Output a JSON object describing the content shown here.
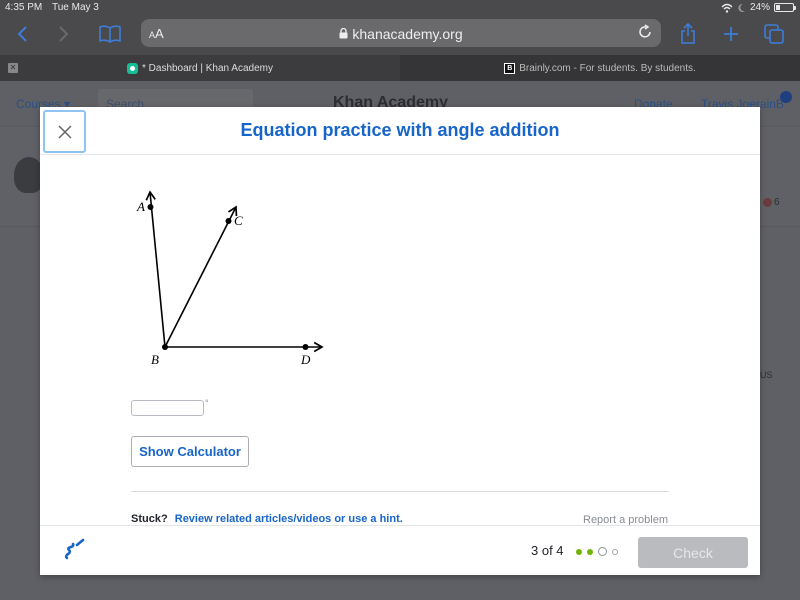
{
  "status_bar": {
    "time": "4:35 PM",
    "date": "Tue May 3",
    "battery_percent": "24%",
    "battery_level": 0.24,
    "icons": [
      "wifi-icon",
      "moon-icon",
      "battery-icon"
    ]
  },
  "browser": {
    "text_size_label": "AA",
    "url": "khanacademy.org",
    "tabs": [
      {
        "title": "* Dashboard | Khan Academy",
        "active": true,
        "icon": "khan-academy-favicon"
      },
      {
        "title": "Brainly.com - For students. By students.",
        "active": false,
        "icon": "brainly-favicon"
      }
    ]
  },
  "background_page": {
    "courses_label": "Courses ▾",
    "search_placeholder": "Search",
    "logo_text": "Khan Academy",
    "donate_label": "Donate",
    "user_name": "Travis JoerainB",
    "badge_count": "6",
    "partial_text": "US"
  },
  "modal": {
    "title": "Equation practice with angle addition",
    "close_label": "×",
    "diagram": {
      "points": [
        {
          "label": "A"
        },
        {
          "label": "B"
        },
        {
          "label": "C"
        },
        {
          "label": "D"
        }
      ],
      "rays": [
        "BA",
        "BC",
        "BD"
      ]
    },
    "answer": {
      "value": "",
      "unit": "°"
    },
    "show_calculator_label": "Show Calculator",
    "stuck_label": "Stuck?",
    "hint_link": "Review related articles/videos or use a hint.",
    "report_label": "Report a problem",
    "footer": {
      "progress_text": "3 of 4",
      "progress_states": [
        "done",
        "done",
        "current",
        "todo"
      ],
      "check_label": "Check"
    }
  },
  "colors": {
    "accent_blue": "#1865c9",
    "progress_green": "#71b307",
    "check_disabled": "#babbbe"
  }
}
